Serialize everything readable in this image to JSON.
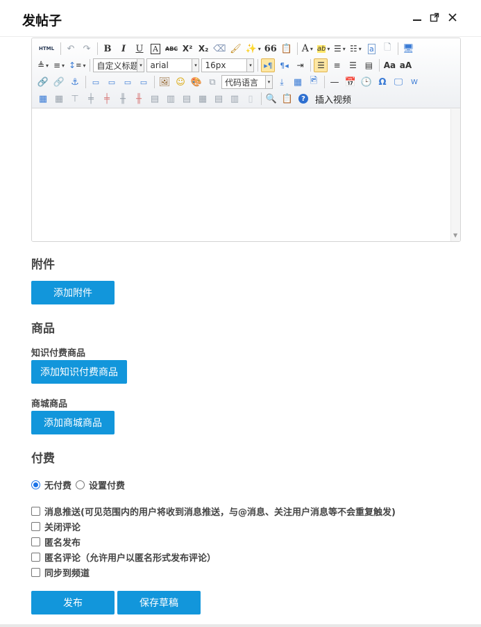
{
  "dialog": {
    "title": "发帖子",
    "minimize_icon": "minimize-icon",
    "maximize_icon": "maximize-icon",
    "close_icon": "close-icon"
  },
  "editor": {
    "toolbar": {
      "html_label": "HTML",
      "bold": "B",
      "italic": "I",
      "underline": "U",
      "font_border": "A",
      "strikethrough": "ABC",
      "superscript": "X²",
      "subscript": "X₂",
      "blockquote": "66",
      "forecolor": "A",
      "backcolor": "ab",
      "paragraph_select": "自定义标题",
      "font_family_select": "arial",
      "font_size_select": "16px",
      "code_language_select": "代码语言",
      "insert_video": "插入视频"
    }
  },
  "attachments": {
    "title": "附件",
    "add_button": "添加附件"
  },
  "products": {
    "title": "商品",
    "knowledge_label": "知识付费商品",
    "add_knowledge_button": "添加知识付费商品",
    "mall_label": "商城商品",
    "add_mall_button": "添加商城商品"
  },
  "payment": {
    "title": "付费",
    "options": [
      {
        "label": "无付费",
        "checked": true
      },
      {
        "label": "设置付费",
        "checked": false
      }
    ]
  },
  "settings": {
    "options": [
      "消息推送(可见范围内的用户将收到消息推送，与@消息、关注用户消息等不会重复触发)",
      "关闭评论",
      "匿名发布",
      "匿名评论（允许用户以匿名形式发布评论）",
      "同步到频道"
    ]
  },
  "actions": {
    "publish": "发布",
    "save_draft": "保存草稿"
  },
  "colors": {
    "primary": "#1296db",
    "radio_checked": "#1a73e8"
  }
}
